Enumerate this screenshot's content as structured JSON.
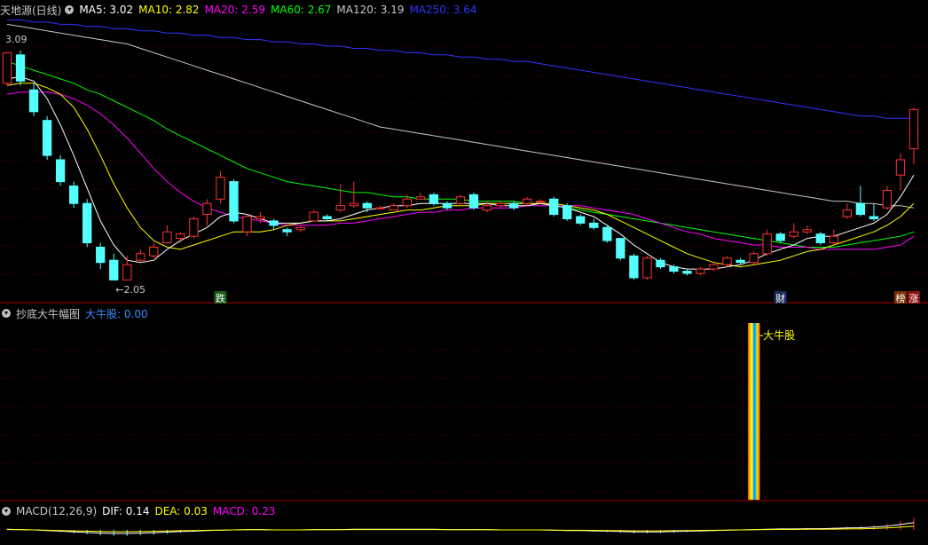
{
  "top": {
    "stock_title": "天地源(日线)",
    "ma_legend": [
      {
        "label": "MA5: 3.02",
        "color": "#ffffff"
      },
      {
        "label": "MA10: 2.82",
        "color": "#ffff00"
      },
      {
        "label": "MA20: 2.59",
        "color": "#ff00ff"
      },
      {
        "label": "MA60: 2.67",
        "color": "#00ff00"
      },
      {
        "label": "MA120: 3.19",
        "color": "#c8c8c8"
      },
      {
        "label": "MA250: 3.64",
        "color": "#3232ff"
      }
    ],
    "high_label": "3.09",
    "low_label": "←2.05",
    "markers": [
      {
        "text": "跌",
        "color": "#ffffff",
        "bg": "#1a5c1a",
        "idx": 16
      },
      {
        "text": "财",
        "color": "#ffffff",
        "bg": "#1a2c5c",
        "idx": 58
      },
      {
        "text": "榜",
        "color": "#ffffff",
        "bg": "#7a3300",
        "idx": 67
      },
      {
        "text": "涨",
        "color": "#ffffff",
        "bg": "#8a1010",
        "idx": 68
      }
    ]
  },
  "mid": {
    "indicator_title": "抄底大牛幅图",
    "value_label": "大牛股: 0.00",
    "signal_label": "大牛股"
  },
  "bottom": {
    "macd_title": "MACD(12,26,9)",
    "dif": "DIF: 0.14",
    "dea": "DEA: 0.03",
    "macd": "MACD: 0.23"
  },
  "colors": {
    "up": "#ff3232",
    "down": "#54ffff",
    "ma5": "#ffffff",
    "ma10": "#ffff00",
    "ma20": "#ff00ff",
    "ma60": "#00ff00",
    "ma120": "#c8c8c8",
    "ma250": "#3232ff",
    "grid": "#5a0000",
    "label_blue": "#3c8cff"
  },
  "chart_data": {
    "type": "candlestick",
    "y_range": [
      1.95,
      3.25
    ],
    "candles": [
      [
        2.95,
        3.09,
        3.09,
        2.94
      ],
      [
        3.08,
        2.96,
        3.1,
        2.94
      ],
      [
        2.92,
        2.82,
        2.95,
        2.8
      ],
      [
        2.78,
        2.62,
        2.8,
        2.6
      ],
      [
        2.6,
        2.5,
        2.62,
        2.48
      ],
      [
        2.48,
        2.4,
        2.5,
        2.38
      ],
      [
        2.4,
        2.22,
        2.42,
        2.2
      ],
      [
        2.2,
        2.13,
        2.22,
        2.1
      ],
      [
        2.14,
        2.05,
        2.17,
        2.05
      ],
      [
        2.05,
        2.12,
        2.16,
        2.05
      ],
      [
        2.14,
        2.17,
        2.19,
        2.13
      ],
      [
        2.16,
        2.2,
        2.22,
        2.15
      ],
      [
        2.22,
        2.27,
        2.3,
        2.22
      ],
      [
        2.24,
        2.26,
        2.27,
        2.22
      ],
      [
        2.25,
        2.33,
        2.34,
        2.24
      ],
      [
        2.35,
        2.4,
        2.42,
        2.3
      ],
      [
        2.42,
        2.52,
        2.55,
        2.4
      ],
      [
        2.5,
        2.32,
        2.51,
        2.31
      ],
      [
        2.27,
        2.34,
        2.35,
        2.25
      ],
      [
        2.33,
        2.34,
        2.36,
        2.31
      ],
      [
        2.32,
        2.3,
        2.33,
        2.28
      ],
      [
        2.28,
        2.27,
        2.29,
        2.25
      ],
      [
        2.28,
        2.29,
        2.3,
        2.27
      ],
      [
        2.32,
        2.36,
        2.37,
        2.32
      ],
      [
        2.34,
        2.33,
        2.35,
        2.32
      ],
      [
        2.37,
        2.39,
        2.49,
        2.36
      ],
      [
        2.39,
        2.4,
        2.5,
        2.38
      ],
      [
        2.4,
        2.38,
        2.41,
        2.36
      ],
      [
        2.38,
        2.38,
        2.39,
        2.37
      ],
      [
        2.37,
        2.39,
        2.4,
        2.37
      ],
      [
        2.39,
        2.42,
        2.44,
        2.38
      ],
      [
        2.42,
        2.43,
        2.45,
        2.42
      ],
      [
        2.44,
        2.4,
        2.45,
        2.39
      ],
      [
        2.4,
        2.38,
        2.41,
        2.37
      ],
      [
        2.4,
        2.43,
        2.44,
        2.39
      ],
      [
        2.44,
        2.38,
        2.45,
        2.37
      ],
      [
        2.37,
        2.39,
        2.41,
        2.36
      ],
      [
        2.39,
        2.4,
        2.41,
        2.38
      ],
      [
        2.4,
        2.38,
        2.41,
        2.37
      ],
      [
        2.4,
        2.42,
        2.43,
        2.39
      ],
      [
        2.41,
        2.41,
        2.42,
        2.4
      ],
      [
        2.42,
        2.35,
        2.43,
        2.34
      ],
      [
        2.39,
        2.33,
        2.4,
        2.32
      ],
      [
        2.34,
        2.31,
        2.35,
        2.3
      ],
      [
        2.31,
        2.29,
        2.33,
        2.28
      ],
      [
        2.29,
        2.23,
        2.3,
        2.22
      ],
      [
        2.24,
        2.15,
        2.24,
        2.14
      ],
      [
        2.16,
        2.06,
        2.17,
        2.05
      ],
      [
        2.06,
        2.15,
        2.16,
        2.05
      ],
      [
        2.14,
        2.11,
        2.15,
        2.1
      ],
      [
        2.11,
        2.09,
        2.12,
        2.08
      ],
      [
        2.09,
        2.08,
        2.1,
        2.07
      ],
      [
        2.08,
        2.1,
        2.11,
        2.07
      ],
      [
        2.1,
        2.12,
        2.13,
        2.09
      ],
      [
        2.12,
        2.15,
        2.16,
        2.11
      ],
      [
        2.14,
        2.13,
        2.15,
        2.12
      ],
      [
        2.13,
        2.17,
        2.18,
        2.12
      ],
      [
        2.17,
        2.26,
        2.28,
        2.16
      ],
      [
        2.26,
        2.23,
        2.27,
        2.22
      ],
      [
        2.25,
        2.27,
        2.31,
        2.24
      ],
      [
        2.27,
        2.28,
        2.3,
        2.26
      ],
      [
        2.26,
        2.22,
        2.27,
        2.21
      ],
      [
        2.22,
        2.25,
        2.28,
        2.21
      ],
      [
        2.34,
        2.37,
        2.4,
        2.33
      ],
      [
        2.4,
        2.35,
        2.48,
        2.34
      ],
      [
        2.34,
        2.33,
        2.4,
        2.32
      ],
      [
        2.38,
        2.46,
        2.48,
        2.37
      ],
      [
        2.53,
        2.6,
        2.63,
        2.46
      ],
      [
        2.65,
        2.83,
        2.84,
        2.58
      ]
    ],
    "ma5": [
      2.97,
      2.98,
      2.96,
      2.88,
      2.76,
      2.62,
      2.47,
      2.32,
      2.21,
      2.14,
      2.13,
      2.14,
      2.19,
      2.23,
      2.26,
      2.29,
      2.34,
      2.36,
      2.35,
      2.33,
      2.31,
      2.31,
      2.31,
      2.32,
      2.32,
      2.33,
      2.35,
      2.37,
      2.38,
      2.39,
      2.39,
      2.4,
      2.4,
      2.4,
      2.4,
      2.4,
      2.4,
      2.39,
      2.39,
      2.39,
      2.4,
      2.39,
      2.38,
      2.36,
      2.34,
      2.3,
      2.26,
      2.21,
      2.17,
      2.13,
      2.11,
      2.1,
      2.1,
      2.1,
      2.11,
      2.12,
      2.14,
      2.17,
      2.19,
      2.21,
      2.24,
      2.25,
      2.25,
      2.27,
      2.29,
      2.31,
      2.35,
      2.43,
      2.53
    ],
    "ma10": [
      2.94,
      2.95,
      2.95,
      2.93,
      2.9,
      2.84,
      2.74,
      2.62,
      2.49,
      2.38,
      2.29,
      2.23,
      2.2,
      2.19,
      2.21,
      2.23,
      2.25,
      2.27,
      2.27,
      2.27,
      2.28,
      2.3,
      2.31,
      2.32,
      2.32,
      2.32,
      2.33,
      2.34,
      2.35,
      2.36,
      2.37,
      2.37,
      2.38,
      2.39,
      2.39,
      2.39,
      2.4,
      2.4,
      2.4,
      2.4,
      2.4,
      2.4,
      2.39,
      2.38,
      2.37,
      2.35,
      2.32,
      2.29,
      2.26,
      2.23,
      2.2,
      2.17,
      2.15,
      2.13,
      2.12,
      2.11,
      2.12,
      2.13,
      2.14,
      2.16,
      2.18,
      2.19,
      2.21,
      2.23,
      2.25,
      2.27,
      2.3,
      2.34,
      2.4
    ],
    "ma20": [
      2.9,
      2.91,
      2.91,
      2.91,
      2.9,
      2.88,
      2.85,
      2.81,
      2.76,
      2.7,
      2.63,
      2.56,
      2.5,
      2.45,
      2.41,
      2.38,
      2.36,
      2.34,
      2.33,
      2.32,
      2.31,
      2.3,
      2.3,
      2.3,
      2.3,
      2.31,
      2.31,
      2.32,
      2.33,
      2.34,
      2.35,
      2.36,
      2.36,
      2.37,
      2.37,
      2.38,
      2.38,
      2.38,
      2.38,
      2.39,
      2.39,
      2.39,
      2.39,
      2.39,
      2.38,
      2.37,
      2.36,
      2.35,
      2.33,
      2.31,
      2.29,
      2.27,
      2.26,
      2.24,
      2.23,
      2.22,
      2.21,
      2.21,
      2.2,
      2.2,
      2.2,
      2.19,
      2.19,
      2.19,
      2.19,
      2.19,
      2.2,
      2.21,
      2.25
    ],
    "ma60": [
      3.05,
      3.03,
      3.01,
      2.99,
      2.97,
      2.95,
      2.92,
      2.9,
      2.87,
      2.84,
      2.81,
      2.78,
      2.74,
      2.71,
      2.68,
      2.65,
      2.62,
      2.59,
      2.56,
      2.54,
      2.52,
      2.5,
      2.49,
      2.48,
      2.47,
      2.46,
      2.45,
      2.45,
      2.44,
      2.43,
      2.43,
      2.42,
      2.42,
      2.42,
      2.42,
      2.41,
      2.41,
      2.41,
      2.41,
      2.4,
      2.4,
      2.39,
      2.38,
      2.37,
      2.36,
      2.35,
      2.34,
      2.33,
      2.32,
      2.31,
      2.3,
      2.29,
      2.28,
      2.27,
      2.26,
      2.25,
      2.24,
      2.23,
      2.22,
      2.21,
      2.2,
      2.2,
      2.2,
      2.21,
      2.22,
      2.23,
      2.24,
      2.25,
      2.27
    ],
    "ma120": [
      3.22,
      3.21,
      3.2,
      3.19,
      3.18,
      3.17,
      3.16,
      3.15,
      3.14,
      3.13,
      3.11,
      3.09,
      3.07,
      3.05,
      3.03,
      3.01,
      2.99,
      2.97,
      2.95,
      2.93,
      2.91,
      2.89,
      2.87,
      2.85,
      2.83,
      2.81,
      2.79,
      2.77,
      2.75,
      2.74,
      2.73,
      2.72,
      2.71,
      2.7,
      2.69,
      2.68,
      2.67,
      2.66,
      2.65,
      2.64,
      2.63,
      2.62,
      2.61,
      2.6,
      2.59,
      2.58,
      2.57,
      2.56,
      2.55,
      2.54,
      2.53,
      2.52,
      2.51,
      2.5,
      2.49,
      2.48,
      2.47,
      2.46,
      2.45,
      2.44,
      2.43,
      2.42,
      2.41,
      2.41,
      2.4,
      2.4,
      2.39,
      2.39,
      2.38
    ],
    "ma250": [
      3.24,
      3.24,
      3.23,
      3.23,
      3.22,
      3.22,
      3.21,
      3.21,
      3.2,
      3.2,
      3.19,
      3.19,
      3.18,
      3.18,
      3.17,
      3.17,
      3.16,
      3.16,
      3.15,
      3.15,
      3.14,
      3.14,
      3.13,
      3.13,
      3.12,
      3.12,
      3.11,
      3.11,
      3.1,
      3.1,
      3.09,
      3.09,
      3.08,
      3.08,
      3.07,
      3.07,
      3.06,
      3.06,
      3.05,
      3.05,
      3.04,
      3.03,
      3.02,
      3.01,
      3.0,
      2.99,
      2.98,
      2.97,
      2.96,
      2.95,
      2.94,
      2.93,
      2.92,
      2.91,
      2.9,
      2.89,
      2.88,
      2.87,
      2.86,
      2.85,
      2.84,
      2.83,
      2.82,
      2.81,
      2.8,
      2.8,
      2.79,
      2.79,
      2.79
    ],
    "signal_index": 56,
    "macd_hist": [
      0.02,
      0.01,
      0.0,
      -0.02,
      -0.04,
      -0.06,
      -0.08,
      -0.1,
      -0.11,
      -0.11,
      -0.1,
      -0.09,
      -0.07,
      -0.05,
      -0.04,
      -0.02,
      -0.01,
      0.0,
      0.01,
      0.01,
      0.0,
      0.0,
      0.0,
      0.01,
      0.01,
      0.01,
      0.02,
      0.02,
      0.02,
      0.02,
      0.02,
      0.02,
      0.02,
      0.01,
      0.01,
      0.01,
      0.01,
      0.0,
      0.0,
      0.0,
      0.0,
      -0.01,
      -0.02,
      -0.02,
      -0.03,
      -0.04,
      -0.05,
      -0.06,
      -0.06,
      -0.06,
      -0.05,
      -0.04,
      -0.03,
      -0.02,
      -0.01,
      0.0,
      0.01,
      0.02,
      0.03,
      0.03,
      0.04,
      0.04,
      0.05,
      0.06,
      0.07,
      0.09,
      0.12,
      0.17,
      0.23
    ]
  }
}
